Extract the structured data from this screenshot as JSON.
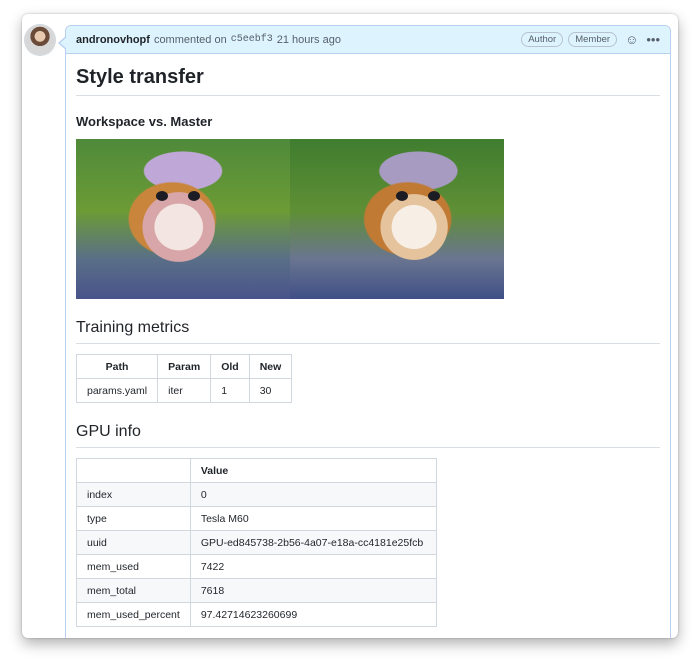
{
  "comment": {
    "author": "andronovhopf",
    "action": "commented on",
    "sha": "c5eebf3",
    "time": "21 hours ago",
    "badges": [
      "Author",
      "Member"
    ],
    "icons": {
      "reaction": "smiley-icon",
      "menu": "kebab-menu-icon"
    }
  },
  "content": {
    "title": "Style transfer",
    "comparison_heading": "Workspace vs. Master",
    "metrics_heading": "Training metrics",
    "metrics_table": {
      "headers": [
        "Path",
        "Param",
        "Old",
        "New"
      ],
      "rows": [
        [
          "params.yaml",
          "iter",
          "1",
          "30"
        ]
      ]
    },
    "gpu_heading": "GPU info",
    "gpu_table": {
      "headers": [
        "",
        "Value"
      ],
      "rows": [
        [
          "index",
          "0"
        ],
        [
          "type",
          "Tesla M60"
        ],
        [
          "uuid",
          "GPU-ed845738-2b56-4a07-e18a-cc4181e25fcb"
        ],
        [
          "mem_used",
          "7422"
        ],
        [
          "mem_total",
          "7618"
        ],
        [
          "mem_used_percent",
          "97.42714623260699"
        ]
      ]
    }
  }
}
